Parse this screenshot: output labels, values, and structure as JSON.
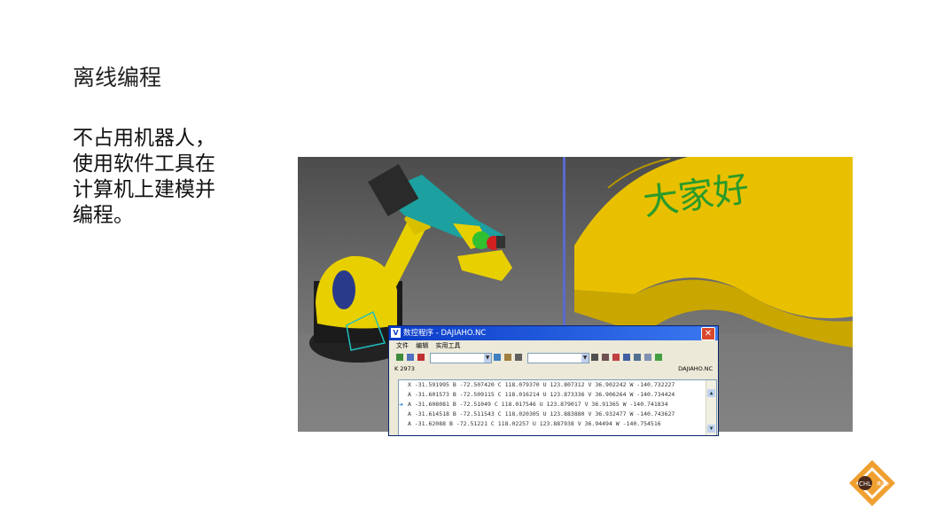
{
  "slide": {
    "title": "离线编程",
    "body_lines": [
      "不占用机器人，",
      "使用软件工具在",
      "计算机上建模并",
      "编程。"
    ]
  },
  "scene": {
    "engraving_text": "大家好"
  },
  "dialog": {
    "title": "数控程序 - DAJIAHO.NC",
    "close_glyph": "✕",
    "menu": [
      "文件",
      "编辑",
      "实用工具"
    ],
    "status_left": "K 2973",
    "status_right": "DAJIAHO.NC",
    "rows": [
      "X -31.591995 B -72.507420 C 118.079370 U 123.807312 V 36.902242 W -140.732227",
      "A -31.601573 B -72.509115 C 118.016214 U 123.873336 V 36.906264 W -140.734424",
      "A -31.608081 B -72.51049 C 118.017546 U 123.879017 V 36.91365 W -140.741834",
      "A -31.614518 B -72.511543 C 118.020305 U 123.883880 V 36.932477 W -140.743627",
      "A -31.62088 B -72.51221 C 118.02257 U 123.887938 V 36.94494 W -140.754516"
    ],
    "current_row_index": 2
  },
  "logo": {
    "text_left": "CHL",
    "text_right": "Rob",
    "colors": {
      "orange": "#f0a030",
      "dark": "#4a2a1a"
    }
  },
  "colors": {
    "robot_yellow": "#e8d000",
    "robot_teal": "#1ca0a0",
    "workpiece": "#e8c000",
    "engraving": "#2a9a2a"
  }
}
